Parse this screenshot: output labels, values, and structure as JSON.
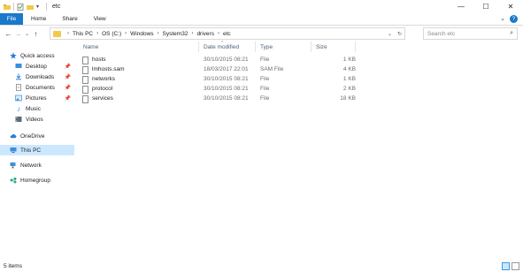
{
  "window": {
    "title": "etc",
    "controls": [
      "minimize",
      "maximize",
      "close"
    ]
  },
  "ribbon": {
    "tabs": [
      "File",
      "Home",
      "Share",
      "View"
    ]
  },
  "address": {
    "crumbs": [
      "This PC",
      "OS (C:)",
      "Windows",
      "System32",
      "drivers",
      "etc"
    ]
  },
  "search": {
    "placeholder": "Search etc"
  },
  "nav": {
    "items": [
      {
        "label": "Quick access",
        "icon": "star-icon",
        "pinned": false
      },
      {
        "label": "Desktop",
        "icon": "desktop-icon",
        "pinned": true
      },
      {
        "label": "Downloads",
        "icon": "download-icon",
        "pinned": true
      },
      {
        "label": "Documents",
        "icon": "documents-icon",
        "pinned": true
      },
      {
        "label": "Pictures",
        "icon": "pictures-icon",
        "pinned": true
      },
      {
        "label": "Music",
        "icon": "music-icon",
        "pinned": false
      },
      {
        "label": "Videos",
        "icon": "videos-icon",
        "pinned": false
      },
      {
        "label": "OneDrive",
        "icon": "cloud-icon",
        "pinned": false
      },
      {
        "label": "This PC",
        "icon": "computer-icon",
        "pinned": false
      },
      {
        "label": "Network",
        "icon": "network-icon",
        "pinned": false
      },
      {
        "label": "Homegroup",
        "icon": "homegroup-icon",
        "pinned": false
      }
    ]
  },
  "columns": {
    "name": "Name",
    "date": "Date modified",
    "type": "Type",
    "size": "Size"
  },
  "files": [
    {
      "name": "hosts",
      "date": "30/10/2015 08:21",
      "type": "File",
      "size": "1 KB"
    },
    {
      "name": "lmhosts.sam",
      "date": "18/03/2017 22:01",
      "type": "SAM File",
      "size": "4 KB"
    },
    {
      "name": "networks",
      "date": "30/10/2015 08:21",
      "type": "File",
      "size": "1 KB"
    },
    {
      "name": "protocol",
      "date": "30/10/2015 08:21",
      "type": "File",
      "size": "2 KB"
    },
    {
      "name": "services",
      "date": "30/10/2015 08:21",
      "type": "File",
      "size": "18 KB"
    }
  ],
  "status": {
    "count": "5 items"
  },
  "colors": {
    "accent": "#1979ca",
    "selection": "#cce8ff",
    "folder": "#f2c94c"
  }
}
